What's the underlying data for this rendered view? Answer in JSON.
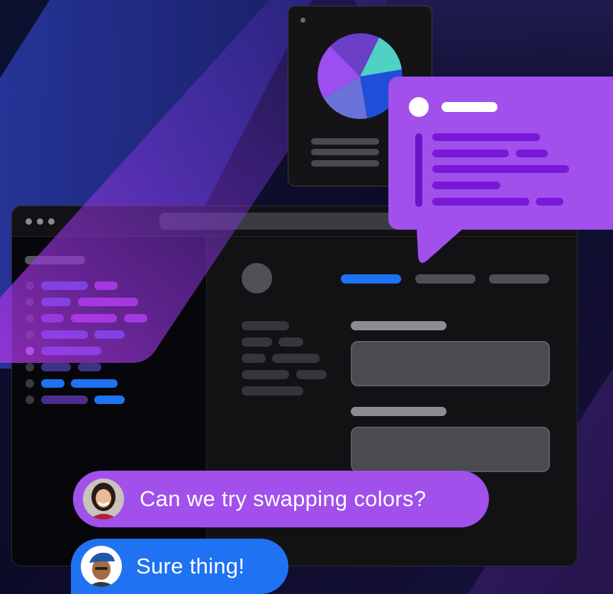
{
  "chat": {
    "messages": [
      {
        "text": "Can we try swapping colors?",
        "avatar": "woman-avatar"
      },
      {
        "text": "Sure thing!",
        "avatar": "man-avatar"
      }
    ]
  },
  "colors": {
    "background": "#0c0b24",
    "purple": "#a150ec",
    "blue": "#1f72f2",
    "window": "#121215",
    "pie_slices": [
      "#6b3fc8",
      "#4fd1c5",
      "#1f4fd8",
      "#6a72d8",
      "#9b4ff0"
    ]
  }
}
